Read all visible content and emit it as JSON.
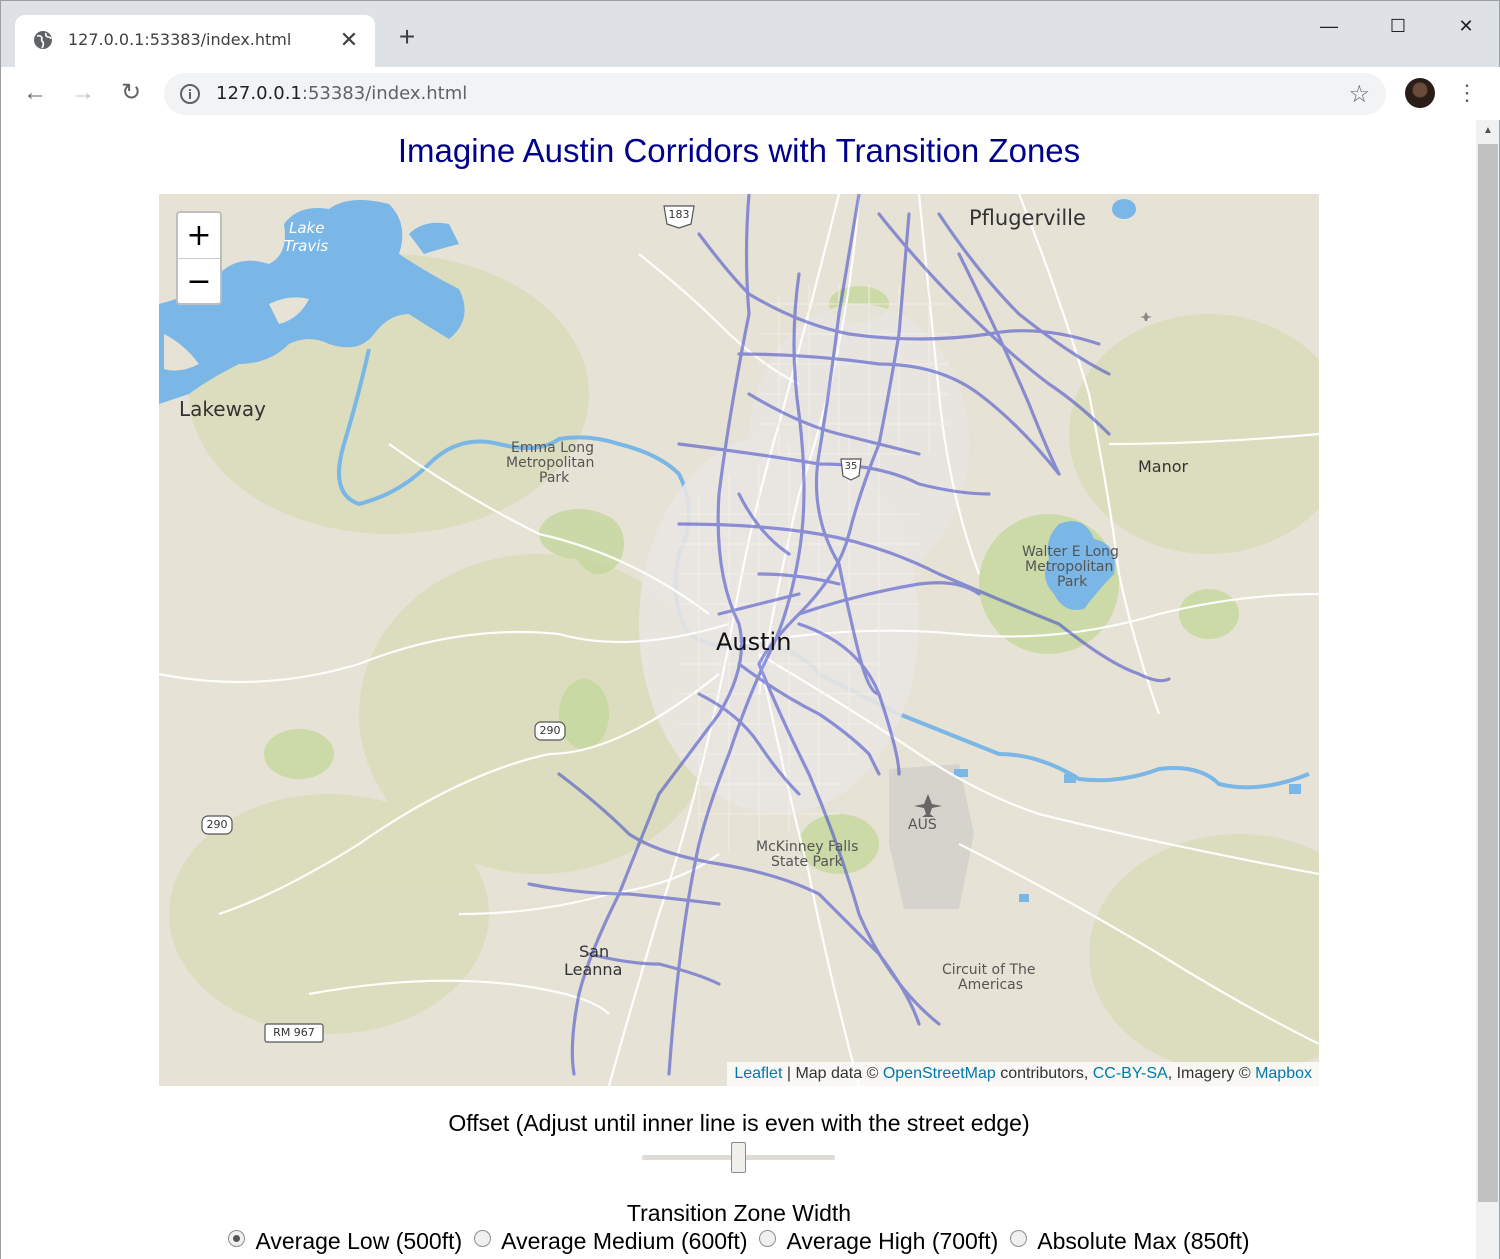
{
  "browser": {
    "tab_title": "127.0.0.1:53383/index.html",
    "url_host": "127.0.0.1",
    "url_rest": ":53383/index.html",
    "new_tab_symbol": "+",
    "close_tab_symbol": "✕",
    "window_controls": {
      "minimize": "—",
      "maximize": "☐",
      "close": "✕"
    }
  },
  "page": {
    "title": "Imagine Austin Corridors with Transition Zones"
  },
  "map": {
    "zoom_in": "+",
    "zoom_out": "−",
    "attribution": {
      "leaflet": "Leaflet",
      "sep1": " | Map data © ",
      "osm": "OpenStreetMap",
      "sep2": " contributors, ",
      "license": "CC-BY-SA",
      "sep3": ", Imagery © ",
      "imagery": "Mapbox"
    },
    "place_labels": {
      "pflugerville": "Pflugerville",
      "lakeway": "Lakeway",
      "manor": "Manor",
      "austin": "Austin",
      "san": "San",
      "leanna": "Leanna",
      "lake": "Lake",
      "travis": "Travis",
      "emma1": "Emma Long",
      "emma2": "Metropolitan",
      "emma3": "Park",
      "walter1": "Walter E Long",
      "walter2": "Metropolitan",
      "walter3": "Park",
      "mck1": "McKinney Falls",
      "mck2": "State Park",
      "cota1": "Circuit of The",
      "cota2": "Americas",
      "aus": "AUS",
      "hwy183": "183",
      "hwy35": "35",
      "hwy290a": "290",
      "hwy290b": "290",
      "rm967": "RM 967"
    },
    "colors": {
      "water": "#7ab6e6",
      "park": "#c8d9a5",
      "land": "#e7e2d6",
      "corridor": "#3b46c8"
    }
  },
  "controls": {
    "offset_label": "Offset (Adjust until inner line is even with the street edge)",
    "offset_value": 0.5,
    "transition_label": "Transition Zone Width",
    "options": [
      {
        "label": "Average Low (500ft)",
        "selected": true
      },
      {
        "label": "Average Medium (600ft)",
        "selected": false
      },
      {
        "label": "Average High (700ft)",
        "selected": false
      },
      {
        "label": "Absolute Max (850ft)",
        "selected": false
      }
    ]
  }
}
